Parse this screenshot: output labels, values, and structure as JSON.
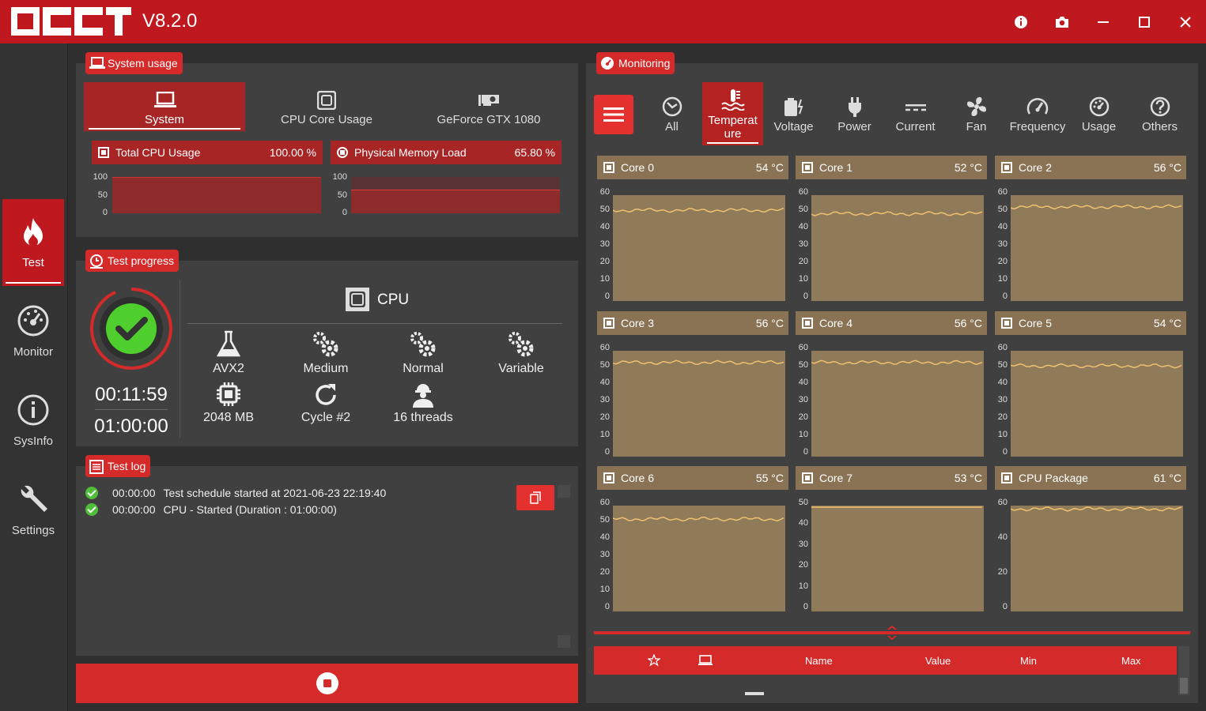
{
  "app": {
    "logo": "OCCT",
    "version": "V8.2.0"
  },
  "window_buttons": [
    "info-icon",
    "camera-icon",
    "minimize-icon",
    "maximize-icon",
    "close-icon"
  ],
  "nav": [
    {
      "label": "Test",
      "icon": "flame-icon",
      "active": true
    },
    {
      "label": "Monitor",
      "icon": "gauge-icon",
      "active": false
    },
    {
      "label": "SysInfo",
      "icon": "info-icon",
      "active": false
    },
    {
      "label": "Settings",
      "icon": "wrench-icon",
      "active": false
    }
  ],
  "system_usage": {
    "title": "System usage",
    "tabs": [
      {
        "label": "System",
        "active": true
      },
      {
        "label": "CPU Core Usage",
        "active": false
      },
      {
        "label": "GeForce GTX 1080",
        "active": false
      }
    ],
    "metrics": [
      {
        "name": "Total CPU Usage",
        "value": "100.00 %",
        "level": 100,
        "axis": [
          "100",
          "50",
          "0"
        ]
      },
      {
        "name": "Physical Memory Load",
        "value": "65.80 %",
        "level": 65.8,
        "axis": [
          "100",
          "50",
          "0"
        ]
      }
    ]
  },
  "test_progress": {
    "title": "Test progress",
    "status": "passed",
    "elapsed": "00:11:59",
    "duration": "01:00:00",
    "target": "CPU",
    "items": [
      {
        "label": "AVX2",
        "icon": "flask-icon"
      },
      {
        "label": "Medium",
        "icon": "gears-icon"
      },
      {
        "label": "Normal",
        "icon": "gears-icon"
      },
      {
        "label": "Variable",
        "icon": "gears-icon"
      },
      {
        "label": "2048 MB",
        "icon": "chip-icon"
      },
      {
        "label": "Cycle #2",
        "icon": "refresh-icon"
      },
      {
        "label": "16 threads",
        "icon": "worker-icon"
      }
    ]
  },
  "test_log": {
    "title": "Test log",
    "lines": [
      {
        "time": "00:00:00",
        "text": "Test schedule started at 2021-06-23 22:19:40"
      },
      {
        "time": "00:00:00",
        "text": "CPU - Started (Duration : 01:00:00)"
      }
    ]
  },
  "monitoring": {
    "title": "Monitoring",
    "tabs": [
      {
        "label": "All",
        "icon": "all-icon"
      },
      {
        "label": "Temperature",
        "line1": "Temperat",
        "line2": "ure",
        "icon": "thermometer-icon",
        "active": true
      },
      {
        "label": "Voltage",
        "icon": "battery-icon"
      },
      {
        "label": "Power",
        "icon": "plug-icon"
      },
      {
        "label": "Current",
        "icon": "current-icon"
      },
      {
        "label": "Fan",
        "icon": "fan-icon"
      },
      {
        "label": "Frequency",
        "icon": "speedometer-icon"
      },
      {
        "label": "Usage",
        "icon": "gauge-icon"
      },
      {
        "label": "Others",
        "icon": "question-icon"
      }
    ],
    "sensors": [
      {
        "name": "Core 0",
        "value": "54 °C",
        "temp": 54,
        "ticks": [
          "60",
          "50",
          "40",
          "30",
          "20",
          "10",
          "0"
        ]
      },
      {
        "name": "Core 1",
        "value": "52 °C",
        "temp": 52,
        "ticks": [
          "60",
          "50",
          "40",
          "30",
          "20",
          "10",
          "0"
        ]
      },
      {
        "name": "Core 2",
        "value": "56 °C",
        "temp": 56,
        "ticks": [
          "60",
          "50",
          "40",
          "30",
          "20",
          "10",
          "0"
        ]
      },
      {
        "name": "Core 3",
        "value": "56 °C",
        "temp": 56,
        "ticks": [
          "60",
          "50",
          "40",
          "30",
          "20",
          "10",
          "0"
        ]
      },
      {
        "name": "Core 4",
        "value": "56 °C",
        "temp": 56,
        "ticks": [
          "60",
          "50",
          "40",
          "30",
          "20",
          "10",
          "0"
        ]
      },
      {
        "name": "Core 5",
        "value": "54 °C",
        "temp": 54,
        "ticks": [
          "60",
          "50",
          "40",
          "30",
          "20",
          "10",
          "0"
        ]
      },
      {
        "name": "Core 6",
        "value": "55 °C",
        "temp": 55,
        "ticks": [
          "60",
          "50",
          "40",
          "30",
          "20",
          "10",
          "0"
        ]
      },
      {
        "name": "Core 7",
        "value": "53 °C",
        "temp": 53,
        "ticks": [
          "50",
          "40",
          "30",
          "20",
          "10",
          "0"
        ]
      },
      {
        "name": "CPU Package",
        "value": "61 °C",
        "temp": 61,
        "ticks": [
          "60",
          "40",
          "20",
          "0"
        ]
      }
    ],
    "table_columns": [
      "Name",
      "Value",
      "Min",
      "Max"
    ]
  },
  "colors": {
    "accent": "#d52a2a",
    "titlebar": "#c0181f",
    "panel": "#404040",
    "plot": "#8f7a5a",
    "line": "#f0c070",
    "ok": "#4fbf3a"
  }
}
